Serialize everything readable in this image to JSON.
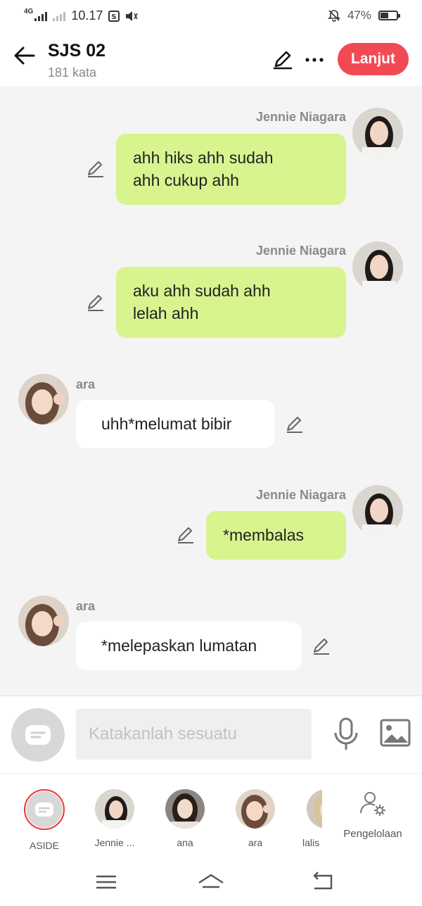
{
  "status": {
    "network": "4G",
    "time": "10.17",
    "battery": "47%",
    "battery_level": 0.47
  },
  "header": {
    "title": "SJS 02",
    "subtitle": "181 kata",
    "next_label": "Lanjut"
  },
  "messages": [
    {
      "sender": "Jennie Niagara",
      "side": "right",
      "lines": [
        "ahh hiks ahh sudah",
        "ahh cukup ahh"
      ]
    },
    {
      "sender": "Jennie Niagara",
      "side": "right",
      "lines": [
        "aku ahh sudah ahh",
        "lelah ahh"
      ]
    },
    {
      "sender": "ara",
      "side": "left",
      "lines": [
        "uhh*melumat bibir"
      ]
    },
    {
      "sender": "Jennie Niagara",
      "side": "right",
      "lines": [
        "*membalas"
      ]
    },
    {
      "sender": "ara",
      "side": "left",
      "lines": [
        "*melepaskan lumatan"
      ]
    }
  ],
  "composer": {
    "placeholder": "Katakanlah sesuatu"
  },
  "characters": [
    {
      "label": "ASIDE"
    },
    {
      "label": "Jennie ..."
    },
    {
      "label": "ana"
    },
    {
      "label": "ara"
    },
    {
      "label": "lalis"
    }
  ],
  "manage_label": "Pengelolaan",
  "colors": {
    "accent": "#f24a55",
    "my_bubble": "#d7f48f",
    "other_bubble": "#ffffff"
  }
}
